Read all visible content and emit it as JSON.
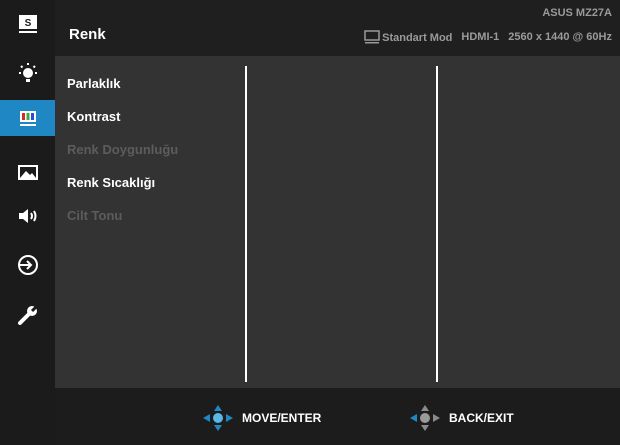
{
  "header": {
    "title": "Renk",
    "model": "ASUS MZ27A",
    "mode": "Standart Mod",
    "input": "HDMI-1",
    "resolution": "2560 x 1440 @ 60Hz"
  },
  "sidebar": {
    "items": [
      {
        "name": "splendid",
        "icon": "s-box-icon"
      },
      {
        "name": "image",
        "icon": "brightness-icon"
      },
      {
        "name": "color",
        "icon": "color-bars-icon",
        "active": true
      },
      {
        "name": "picture",
        "icon": "mountain-image-icon"
      },
      {
        "name": "sound",
        "icon": "speaker-icon"
      },
      {
        "name": "input",
        "icon": "input-select-icon"
      },
      {
        "name": "system",
        "icon": "wrench-icon"
      }
    ],
    "s_label": "S"
  },
  "menu": {
    "items": [
      {
        "label": "Parlaklık",
        "enabled": true
      },
      {
        "label": "Kontrast",
        "enabled": true
      },
      {
        "label": "Renk Doygunluğu",
        "enabled": false
      },
      {
        "label": "Renk Sıcaklığı",
        "enabled": true
      },
      {
        "label": "Cilt Tonu",
        "enabled": false
      }
    ]
  },
  "footer": {
    "move_label": "MOVE/ENTER",
    "back_label": "BACK/EXIT"
  },
  "colors": {
    "accent": "#1e87c4",
    "background": "#333333",
    "sidebar": "#1b1b1b"
  }
}
